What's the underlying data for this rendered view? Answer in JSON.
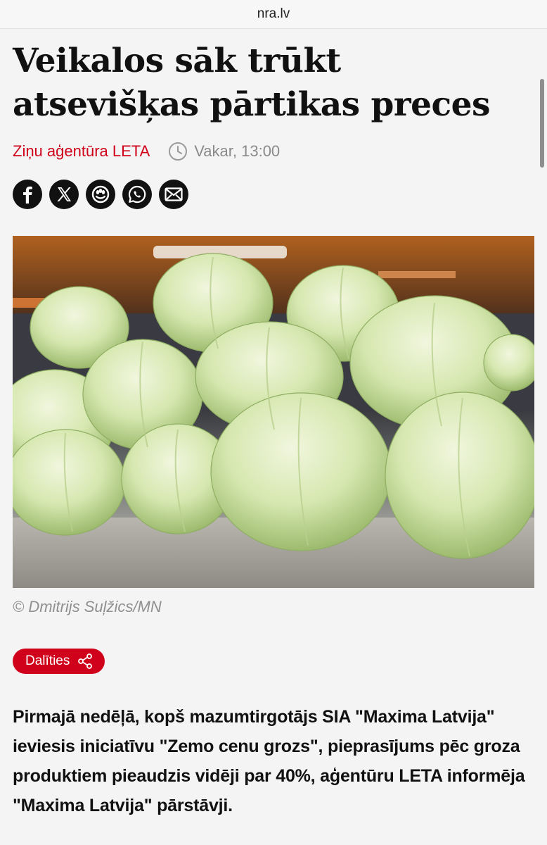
{
  "browser": {
    "url": "nra.lv"
  },
  "article": {
    "title": "Veikalos sāk trūkt atsevišķas pārtikas preces",
    "author": "Ziņu aģentūra LETA",
    "time": "Vakar, 13:00",
    "photo_credit": "© Dmitrijs Suļžics/MN",
    "share_label": "Dalīties",
    "lead": "Pirmajā nedēļā, kopš mazumtirgotājs SIA \"Maxima Latvija\" ieviesis iniciatīvu \"Zemo cenu grozs\", pieprasījums pēc groza produktiem pieaudzis vidēji par 40%, aģentūru LETA informēja \"Maxima Latvija\" pārstāvji."
  },
  "social_icons": [
    "facebook-icon",
    "x-icon",
    "draugiem-icon",
    "whatsapp-icon",
    "email-icon"
  ],
  "colors": {
    "accent": "#d0021b",
    "icon_bg": "#111111",
    "muted": "#8a8a8a"
  }
}
